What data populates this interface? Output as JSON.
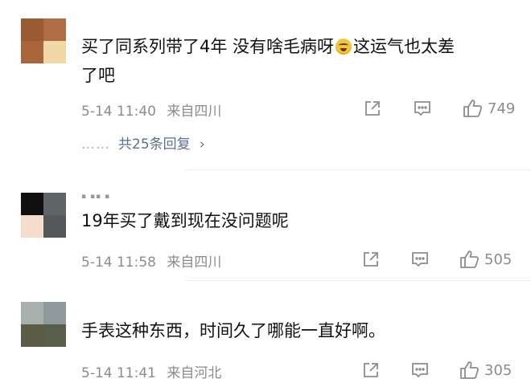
{
  "comments": [
    {
      "avatar_colors": [
        "#9a5a34",
        "#b06c45",
        "#a8663a",
        "#f1d9a7"
      ],
      "text_before": "买了同系列带了4年 没有啥毛病呀",
      "emoji": "laughing-crying-emoji",
      "text_after": "这运气也太差",
      "text_line2": "了吧",
      "date": "5-14 11:40",
      "location": "来自四川",
      "likes": "749",
      "replies": "共25条回复",
      "replies_dots": "……"
    },
    {
      "avatar_colors": [
        "#101010",
        "#5f6466",
        "#f6dccb",
        "#55595a"
      ],
      "handle": "▪ ▪▪ ▪",
      "text": "19年买了戴到现在没问题呢",
      "date": "5-14 11:58",
      "location": "来自四川",
      "likes": "505"
    },
    {
      "avatar_colors": [
        "#a7b0ad",
        "#8d999a",
        "#5c5b45",
        "#585e49"
      ],
      "text": "手表这种东西，时间久了哪能一直好啊。",
      "date": "5-14 11:41",
      "location": "来自河北",
      "likes": "305"
    }
  ]
}
